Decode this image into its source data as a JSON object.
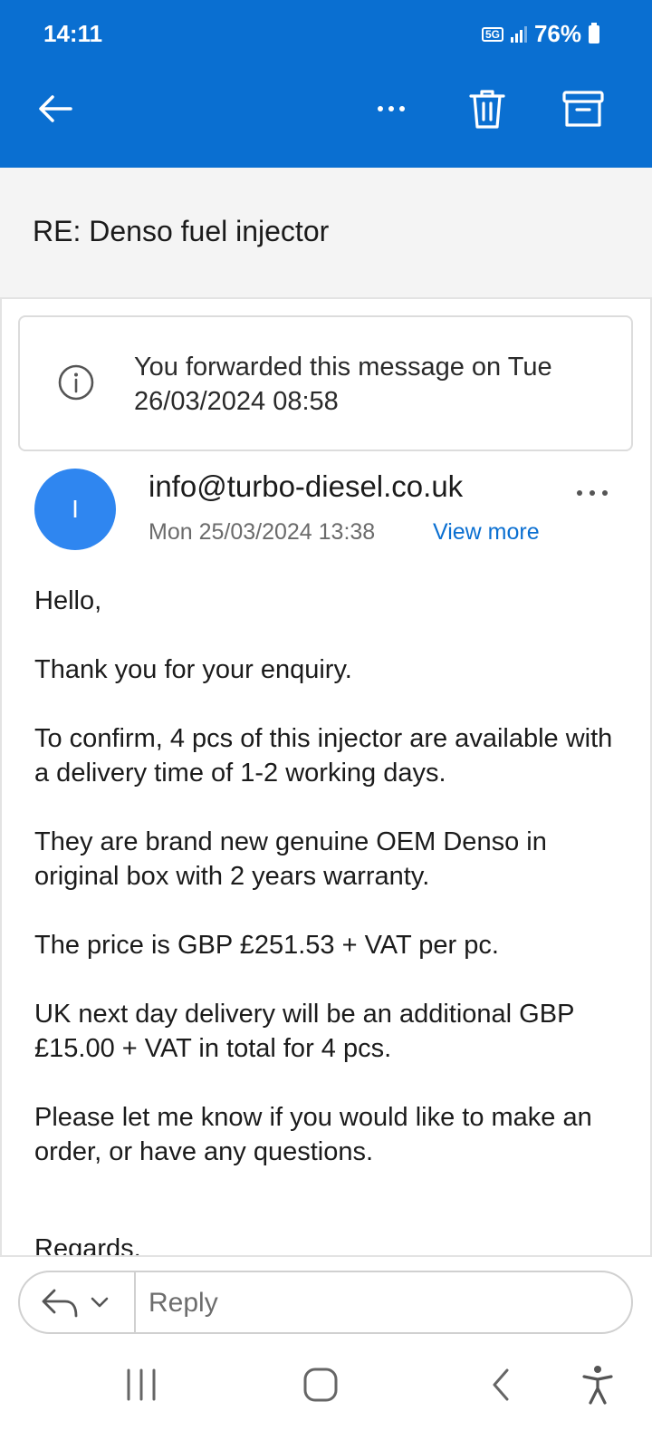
{
  "status_bar": {
    "time": "14:11",
    "network": "5G",
    "battery": "76%"
  },
  "toolbar": {
    "back_icon": "arrow-left-icon",
    "more_icon": "more-horizontal-icon",
    "delete_icon": "trash-icon",
    "archive_icon": "archive-icon"
  },
  "subject": "RE: Denso fuel injector",
  "forward_notice": "You forwarded this message on Tue 26/03/2024 08:58",
  "message": {
    "avatar_initial": "I",
    "sender": "info@turbo-diesel.co.uk",
    "date": "Mon 25/03/2024 13:38",
    "view_more": "View more",
    "body": [
      "Hello,",
      "Thank you for your enquiry.",
      "To confirm, 4 pcs of this injector are available with a delivery time of 1-2 working days.",
      "They are brand new genuine OEM Denso in original box with 2 years warranty.",
      "The price is GBP £251.53 + VAT per pc.",
      "UK next day delivery will be an additional GBP £15.00 + VAT in total for 4 pcs.",
      "Please let me know if you would like to make an order, or have any questions."
    ],
    "partial_line": "Regards,"
  },
  "reply": {
    "placeholder": "Reply"
  },
  "colors": {
    "brand": "#0a6fd1",
    "avatar": "#2f86f0"
  }
}
